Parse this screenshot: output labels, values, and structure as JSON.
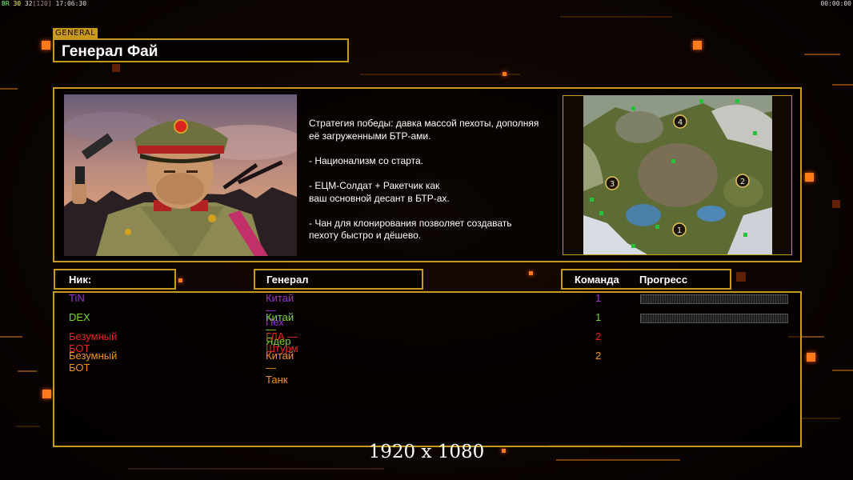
{
  "overlay": {
    "fps_parts": [
      "BR",
      "30",
      "32",
      "[120]",
      "17:06:30"
    ],
    "clock": "00:00:00"
  },
  "header": {
    "tag": "GENERAL",
    "general_name": "Генерал Фай"
  },
  "info": {
    "description": "Стратегия победы: давка массой пехоты, дополняя\n её загруженными БТР-ами.\n\n- Национализм со старта.\n\n- ЕЦМ-Солдат + Ракетчик как\nваш основной десант в БТР-ах.\n\n- Чан для клонирования позволяет создавать\n пехоту быстро и дёшево.",
    "map_spawns": [
      "4",
      "3",
      "2",
      "1"
    ]
  },
  "columns": {
    "nick": "Ник:",
    "general": "Генерал",
    "team": "Команда",
    "progress": "Прогресс"
  },
  "players": [
    {
      "nick": "TiN",
      "general": "Китай — Пех",
      "team": "1",
      "color": "#9a33d8",
      "progress_shown": true
    },
    {
      "nick": "DEX",
      "general": "Китай — Ядер",
      "team": "1",
      "color": "#7bd62a",
      "progress_shown": true
    },
    {
      "nick": "Безумный БОТ",
      "general": "ГЛА — Штурм",
      "team": "2",
      "color": "#e8241c",
      "progress_shown": false
    },
    {
      "nick": "Безумный БОТ",
      "general": "Китай — Танк",
      "team": "2",
      "color": "#f0951e",
      "progress_shown": false
    }
  ],
  "resolution": "1920 x 1080",
  "colors": {
    "frame": "#c79a1e",
    "accent_orange": "#ff7a1a"
  }
}
